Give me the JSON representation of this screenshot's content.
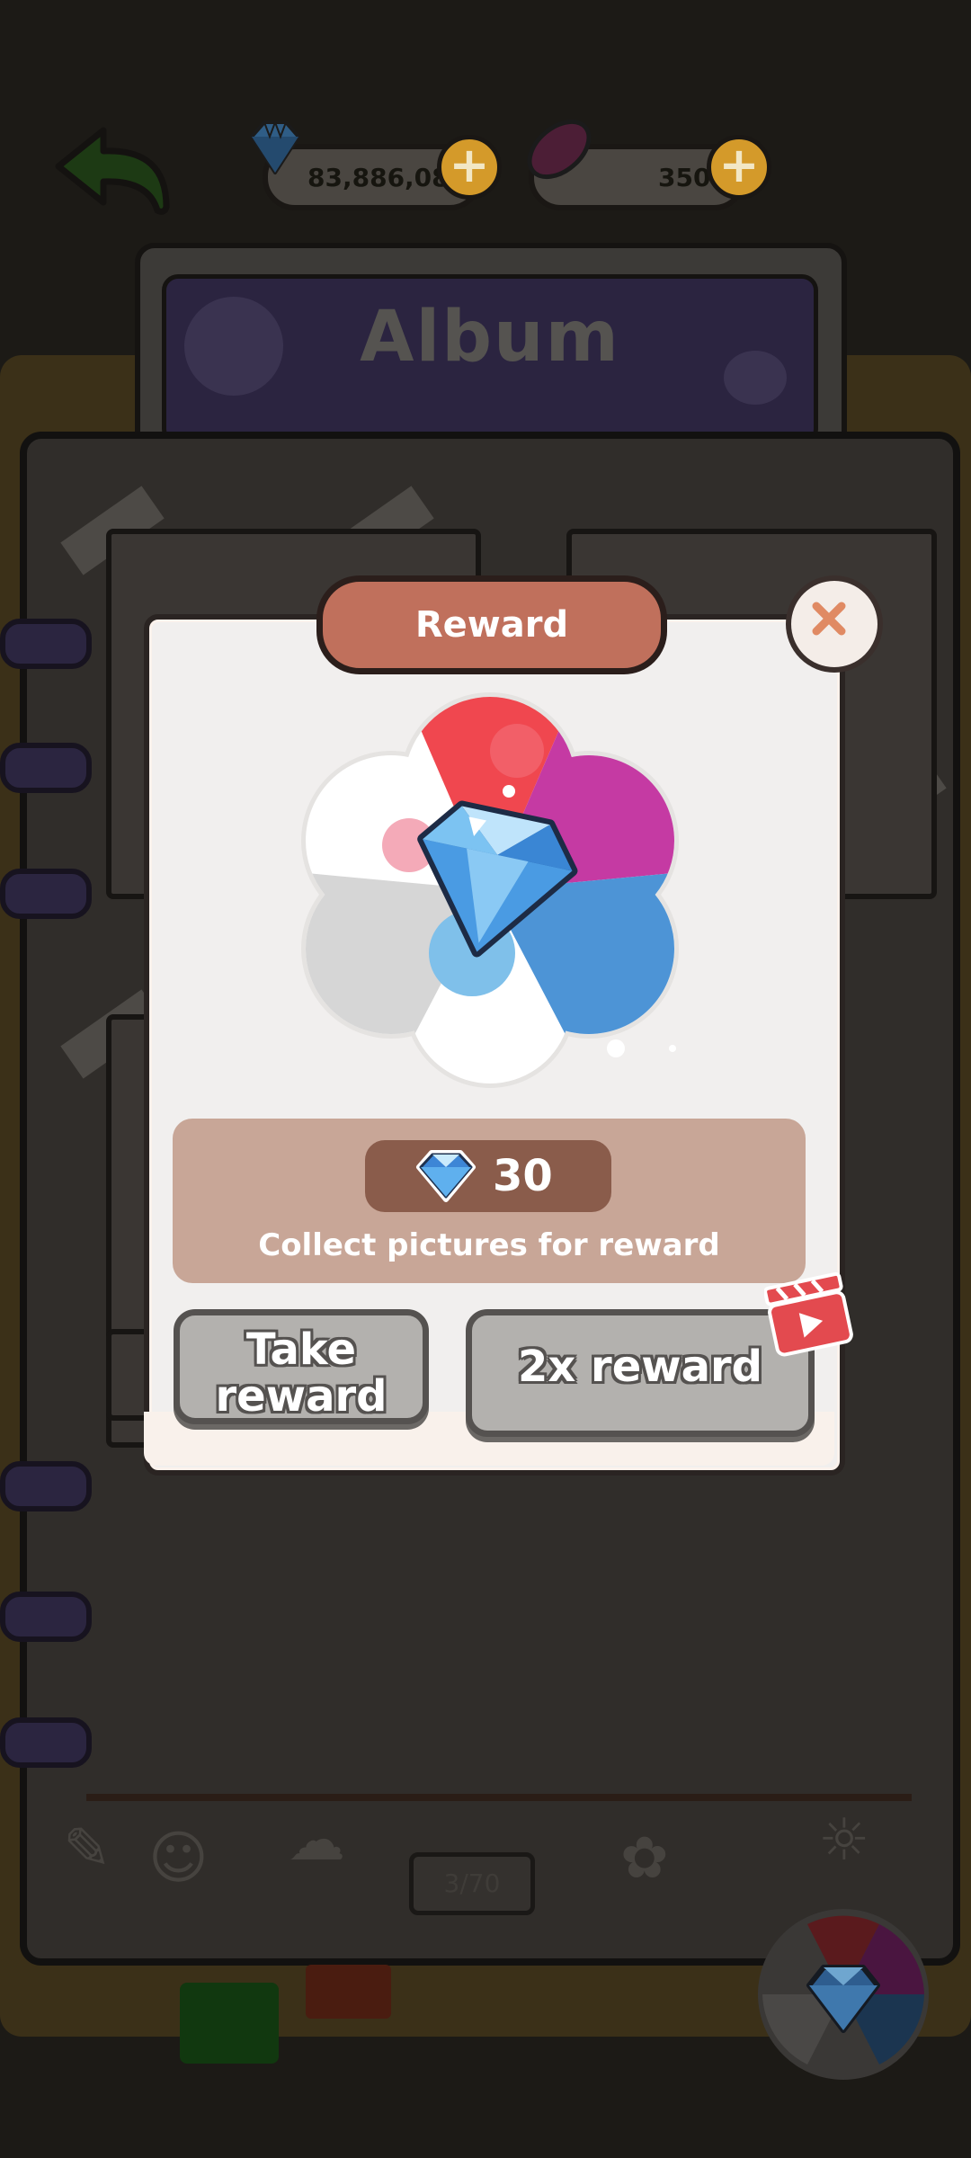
{
  "header": {
    "gems_value": "83,886,080",
    "potato_value": "350",
    "plus_symbol": "+"
  },
  "album": {
    "title": "Album",
    "page_counter": "3/70"
  },
  "dialog": {
    "title": "Reward",
    "reward_amount": "30",
    "reward_description": "Collect pictures for reward",
    "take_button_line1": "Take",
    "take_button_line2": "reward",
    "double_button": "2x reward"
  },
  "colors": {
    "dialog_title_bg": "#c0705c",
    "reward_box_bg": "#c8a697",
    "amount_pill_bg": "#8a5c4b",
    "button_bg": "#b3b1ae",
    "plus_button": "#d49a2a"
  },
  "icons": {
    "back": "back-arrow-icon",
    "gem": "diamond-icon",
    "potato": "sweet-potato-icon",
    "close": "close-icon",
    "video": "clapperboard-video-icon"
  }
}
